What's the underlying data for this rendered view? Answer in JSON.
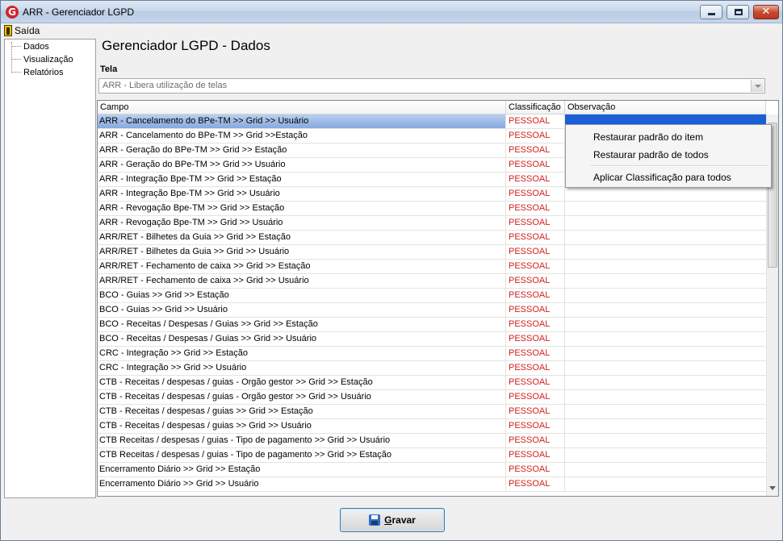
{
  "window": {
    "title": "ARR - Gerenciador LGPD"
  },
  "menubar": {
    "items": [
      {
        "label": "Saída",
        "icon": "door-exit-icon"
      }
    ]
  },
  "tree": {
    "items": [
      "Dados",
      "Visualização",
      "Relatórios"
    ]
  },
  "page": {
    "title": "Gerenciador LGPD - Dados"
  },
  "tela": {
    "label": "Tela",
    "value": "ARR - Libera utilização de telas"
  },
  "grid": {
    "columns": [
      "Campo",
      "Classificação",
      "Observação"
    ],
    "rows": [
      [
        "ARR - Cancelamento do BPe-TM >> Grid >> Usuário",
        "PESSOAL",
        ""
      ],
      [
        "ARR - Cancelamento do BPe-TM >> Grid >>Estação",
        "PESSOAL",
        ""
      ],
      [
        "ARR - Geração do BPe-TM >> Grid >> Estação",
        "PESSOAL",
        ""
      ],
      [
        "ARR - Geração do BPe-TM >> Grid >> Usuário",
        "PESSOAL",
        ""
      ],
      [
        "ARR - Integração Bpe-TM >> Grid >> Estação",
        "PESSOAL",
        ""
      ],
      [
        "ARR - Integração Bpe-TM >> Grid >> Usuário",
        "PESSOAL",
        ""
      ],
      [
        "ARR - Revogação Bpe-TM >> Grid >> Estação",
        "PESSOAL",
        ""
      ],
      [
        "ARR - Revogação Bpe-TM >> Grid >> Usuário",
        "PESSOAL",
        ""
      ],
      [
        "ARR/RET - Bilhetes da Guia >> Grid >> Estação",
        "PESSOAL",
        ""
      ],
      [
        "ARR/RET - Bilhetes da Guia >> Grid >> Usuário",
        "PESSOAL",
        ""
      ],
      [
        "ARR/RET - Fechamento de caixa >> Grid >> Estação",
        "PESSOAL",
        ""
      ],
      [
        "ARR/RET - Fechamento de caixa >> Grid >> Usuário",
        "PESSOAL",
        ""
      ],
      [
        "BCO - Guias >> Grid >> Estação",
        "PESSOAL",
        ""
      ],
      [
        "BCO - Guias >> Grid >> Usuário",
        "PESSOAL",
        ""
      ],
      [
        "BCO - Receitas / Despesas / Guias >> Grid >> Estação",
        "PESSOAL",
        ""
      ],
      [
        "BCO - Receitas / Despesas / Guias >> Grid >> Usuário",
        "PESSOAL",
        ""
      ],
      [
        "CRC - Integração >> Grid >> Estação",
        "PESSOAL",
        ""
      ],
      [
        "CRC - Integração >> Grid >> Usuário",
        "PESSOAL",
        ""
      ],
      [
        "CTB - Receitas / despesas / guias - Orgão gestor >> Grid >> Estação",
        "PESSOAL",
        ""
      ],
      [
        "CTB - Receitas / despesas / guias - Orgão gestor >> Grid >> Usuário",
        "PESSOAL",
        ""
      ],
      [
        "CTB - Receitas / despesas / guias >> Grid >> Estação",
        "PESSOAL",
        ""
      ],
      [
        "CTB - Receitas / despesas / guias >> Grid >> Usuário",
        "PESSOAL",
        ""
      ],
      [
        "CTB Receitas / despesas / guias - Tipo de pagamento >> Grid >>  Usuário",
        "PESSOAL",
        ""
      ],
      [
        "CTB Receitas / despesas / guias - Tipo de pagamento >> Grid >> Estação",
        "PESSOAL",
        ""
      ],
      [
        "Encerramento Diário >> Grid >> Estação",
        "PESSOAL",
        ""
      ],
      [
        "Encerramento Diário >> Grid >> Usuário",
        "PESSOAL",
        ""
      ]
    ]
  },
  "context_menu": {
    "items": [
      "Restaurar padrão do item",
      "Restaurar padrão de todos",
      "Aplicar Classificação para todos"
    ]
  },
  "buttons": {
    "save_label_rest": "ravar",
    "save_accel": "G"
  },
  "colors": {
    "classification_text": "#d21f1f",
    "selection": "#1a5fd6",
    "accent": "#3c7fb1"
  }
}
